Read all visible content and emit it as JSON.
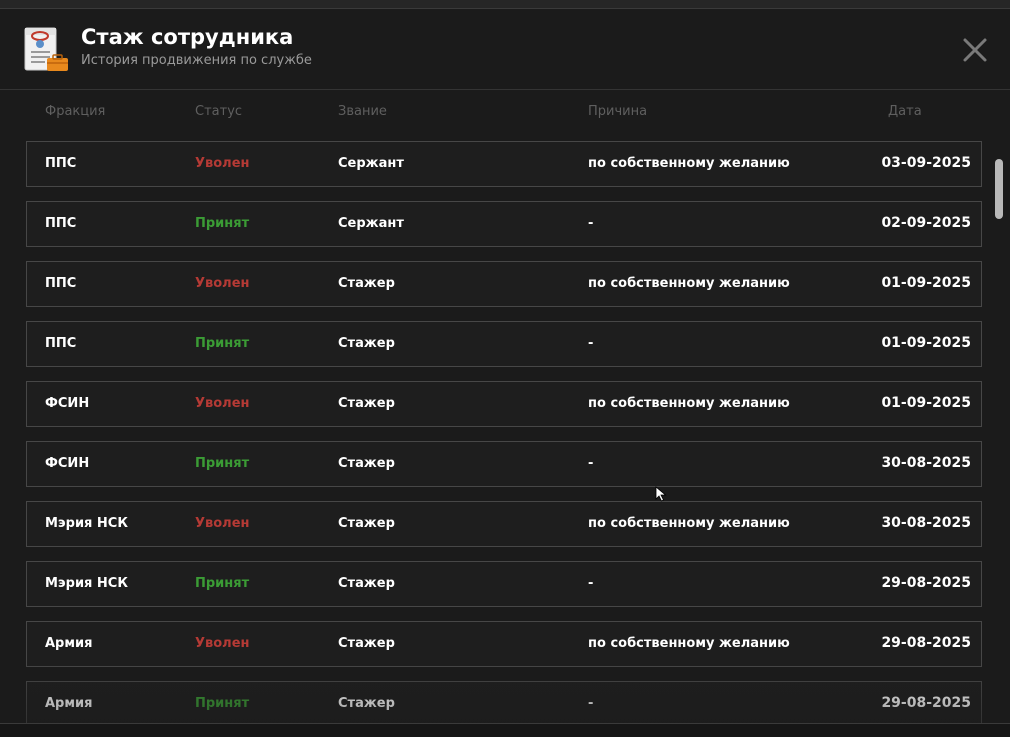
{
  "header": {
    "title": "Стаж сотрудника",
    "subtitle": "История продвижения по службе",
    "icon": "document-briefcase-icon",
    "close_icon": "close-icon"
  },
  "columns": {
    "fraction": "Фракция",
    "status": "Статус",
    "rank": "Звание",
    "reason": "Причина",
    "date": "Дата"
  },
  "colors": {
    "fired": "#b53a35",
    "hired": "#3b9c35",
    "background": "#1b1b1b",
    "row_border": "#474747"
  },
  "rows": [
    {
      "fraction": "ППС",
      "status": "Уволен",
      "status_type": "fired",
      "rank": "Сержант",
      "reason": "по собственному желанию",
      "date": "03-09-2025"
    },
    {
      "fraction": "ППС",
      "status": "Принят",
      "status_type": "hired",
      "rank": "Сержант",
      "reason": "-",
      "date": "02-09-2025"
    },
    {
      "fraction": "ППС",
      "status": "Уволен",
      "status_type": "fired",
      "rank": "Стажер",
      "reason": "по собственному желанию",
      "date": "01-09-2025"
    },
    {
      "fraction": "ППС",
      "status": "Принят",
      "status_type": "hired",
      "rank": "Стажер",
      "reason": "-",
      "date": "01-09-2025"
    },
    {
      "fraction": "ФСИН",
      "status": "Уволен",
      "status_type": "fired",
      "rank": "Стажер",
      "reason": "по собственному желанию",
      "date": "01-09-2025"
    },
    {
      "fraction": "ФСИН",
      "status": "Принят",
      "status_type": "hired",
      "rank": "Стажер",
      "reason": "-",
      "date": "30-08-2025"
    },
    {
      "fraction": "Мэрия НСК",
      "status": "Уволен",
      "status_type": "fired",
      "rank": "Стажер",
      "reason": "по собственному желанию",
      "date": "30-08-2025"
    },
    {
      "fraction": "Мэрия НСК",
      "status": "Принят",
      "status_type": "hired",
      "rank": "Стажер",
      "reason": "-",
      "date": "29-08-2025"
    },
    {
      "fraction": "Армия",
      "status": "Уволен",
      "status_type": "fired",
      "rank": "Стажер",
      "reason": "по собственному желанию",
      "date": "29-08-2025"
    },
    {
      "fraction": "Армия",
      "status": "Принят",
      "status_type": "hired",
      "rank": "Стажер",
      "reason": "-",
      "date": "29-08-2025"
    }
  ]
}
